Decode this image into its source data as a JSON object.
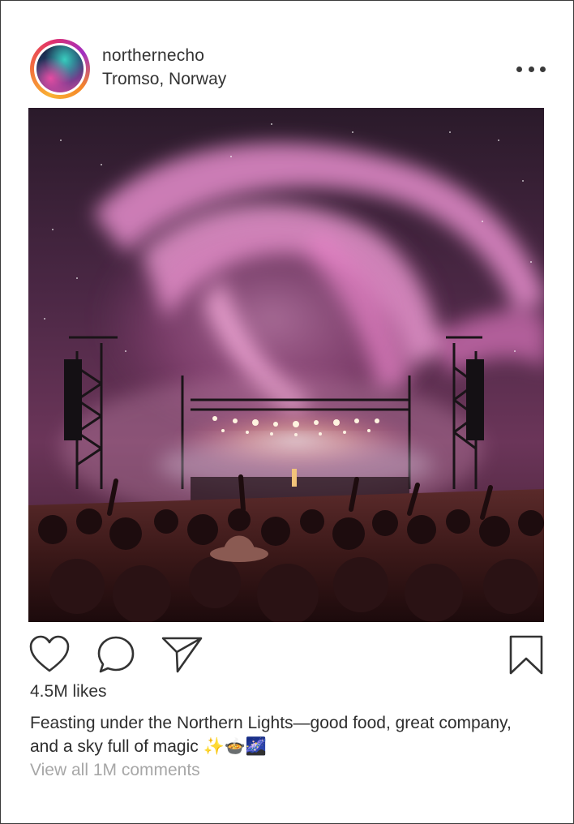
{
  "post": {
    "username": "northernecho",
    "location": "Tromso, Norway",
    "likes": "4.5M likes",
    "caption": "Feasting under the Northern Lights—good food, great company, and a sky full of magic ✨🍲🌌",
    "comments_link": "View all 1M comments",
    "image_description_icon": "concert-aurora-photo"
  },
  "icons": {
    "more": "more-options-icon",
    "like": "heart-icon",
    "comment": "comment-bubble-icon",
    "share": "paper-plane-icon",
    "save": "bookmark-icon"
  },
  "colors": {
    "text": "#2e2e2e",
    "muted": "#a7a7a7",
    "aurora_pink": "#e889c8",
    "story_ring": "#e1306c"
  }
}
